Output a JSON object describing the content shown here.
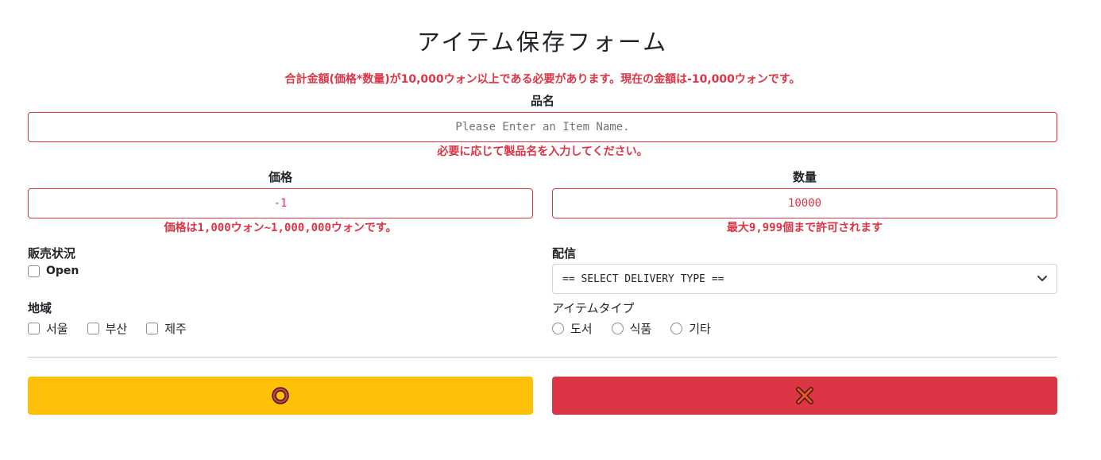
{
  "form": {
    "title": "アイテム保存フォーム",
    "global_error": "合計金額(価格*数量)が10,000ウォン以上である必要があります。現在の金額は-10,000ウォンです。",
    "item_name": {
      "label": "品名",
      "placeholder": "Please Enter an Item Name.",
      "value": "",
      "error": "必要に応じて製品名を入力してください。"
    },
    "price": {
      "label": "価格",
      "value": "-1",
      "error": "価格は1,000ウォン~1,000,000ウォンです。"
    },
    "quantity": {
      "label": "数量",
      "value": "10000",
      "error": "最大9,999個まで許可されます"
    },
    "sale_status": {
      "label": "販売状況",
      "option": "Open",
      "checked": false
    },
    "delivery": {
      "label": "配信",
      "selected": "== SELECT DELIVERY TYPE =="
    },
    "region": {
      "label": "地域",
      "options": [
        "서울",
        "부산",
        "제주"
      ]
    },
    "item_type": {
      "label": "アイテムタイプ",
      "options": [
        "도서",
        "식품",
        "기타"
      ]
    },
    "buttons": {
      "submit_icon": "circle-icon",
      "cancel_icon": "x-icon",
      "submit_color": "#ffc107",
      "cancel_color": "#dc3545"
    }
  }
}
